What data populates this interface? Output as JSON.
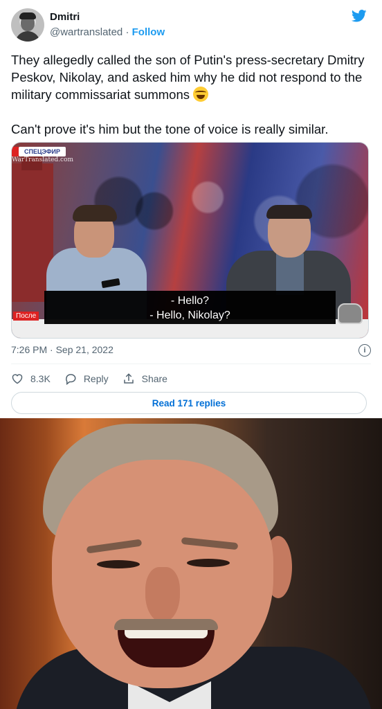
{
  "tweet": {
    "author_name": "Dmitri",
    "handle": "@wartranslated",
    "separator": " · ",
    "follow_label": "Follow",
    "text_paragraph_1": "They allegedly called the son of Putin's press-secretary Dmitry Peskov, Nikolay, and asked him why he did not respond to the military commissariat summons",
    "text_paragraph_2": "Can't prove it's him but the tone of voice is really similar.",
    "emoji": "laughing-face-emoji",
    "timestamp": "7:26 PM · Sep 21, 2022",
    "like_count": "8.3K",
    "reply_label": "Reply",
    "share_label": "Share",
    "read_replies_label": "Read 171 replies"
  },
  "video": {
    "badge": "СПЕЦЭФИР",
    "watermark": "WarTranslated.com",
    "subtitle_line_1": "- Hello?",
    "subtitle_line_2": "- Hello, Nikolay?",
    "lower_tag": "После"
  },
  "colors": {
    "accent": "#1d9bf0",
    "link": "#006fd6",
    "secondary_text": "#536471",
    "text": "#0f1419"
  },
  "icons": [
    "twitter-bird-icon",
    "info-icon",
    "heart-icon",
    "reply-bubble-icon",
    "share-icon",
    "fist-logo-icon"
  ]
}
